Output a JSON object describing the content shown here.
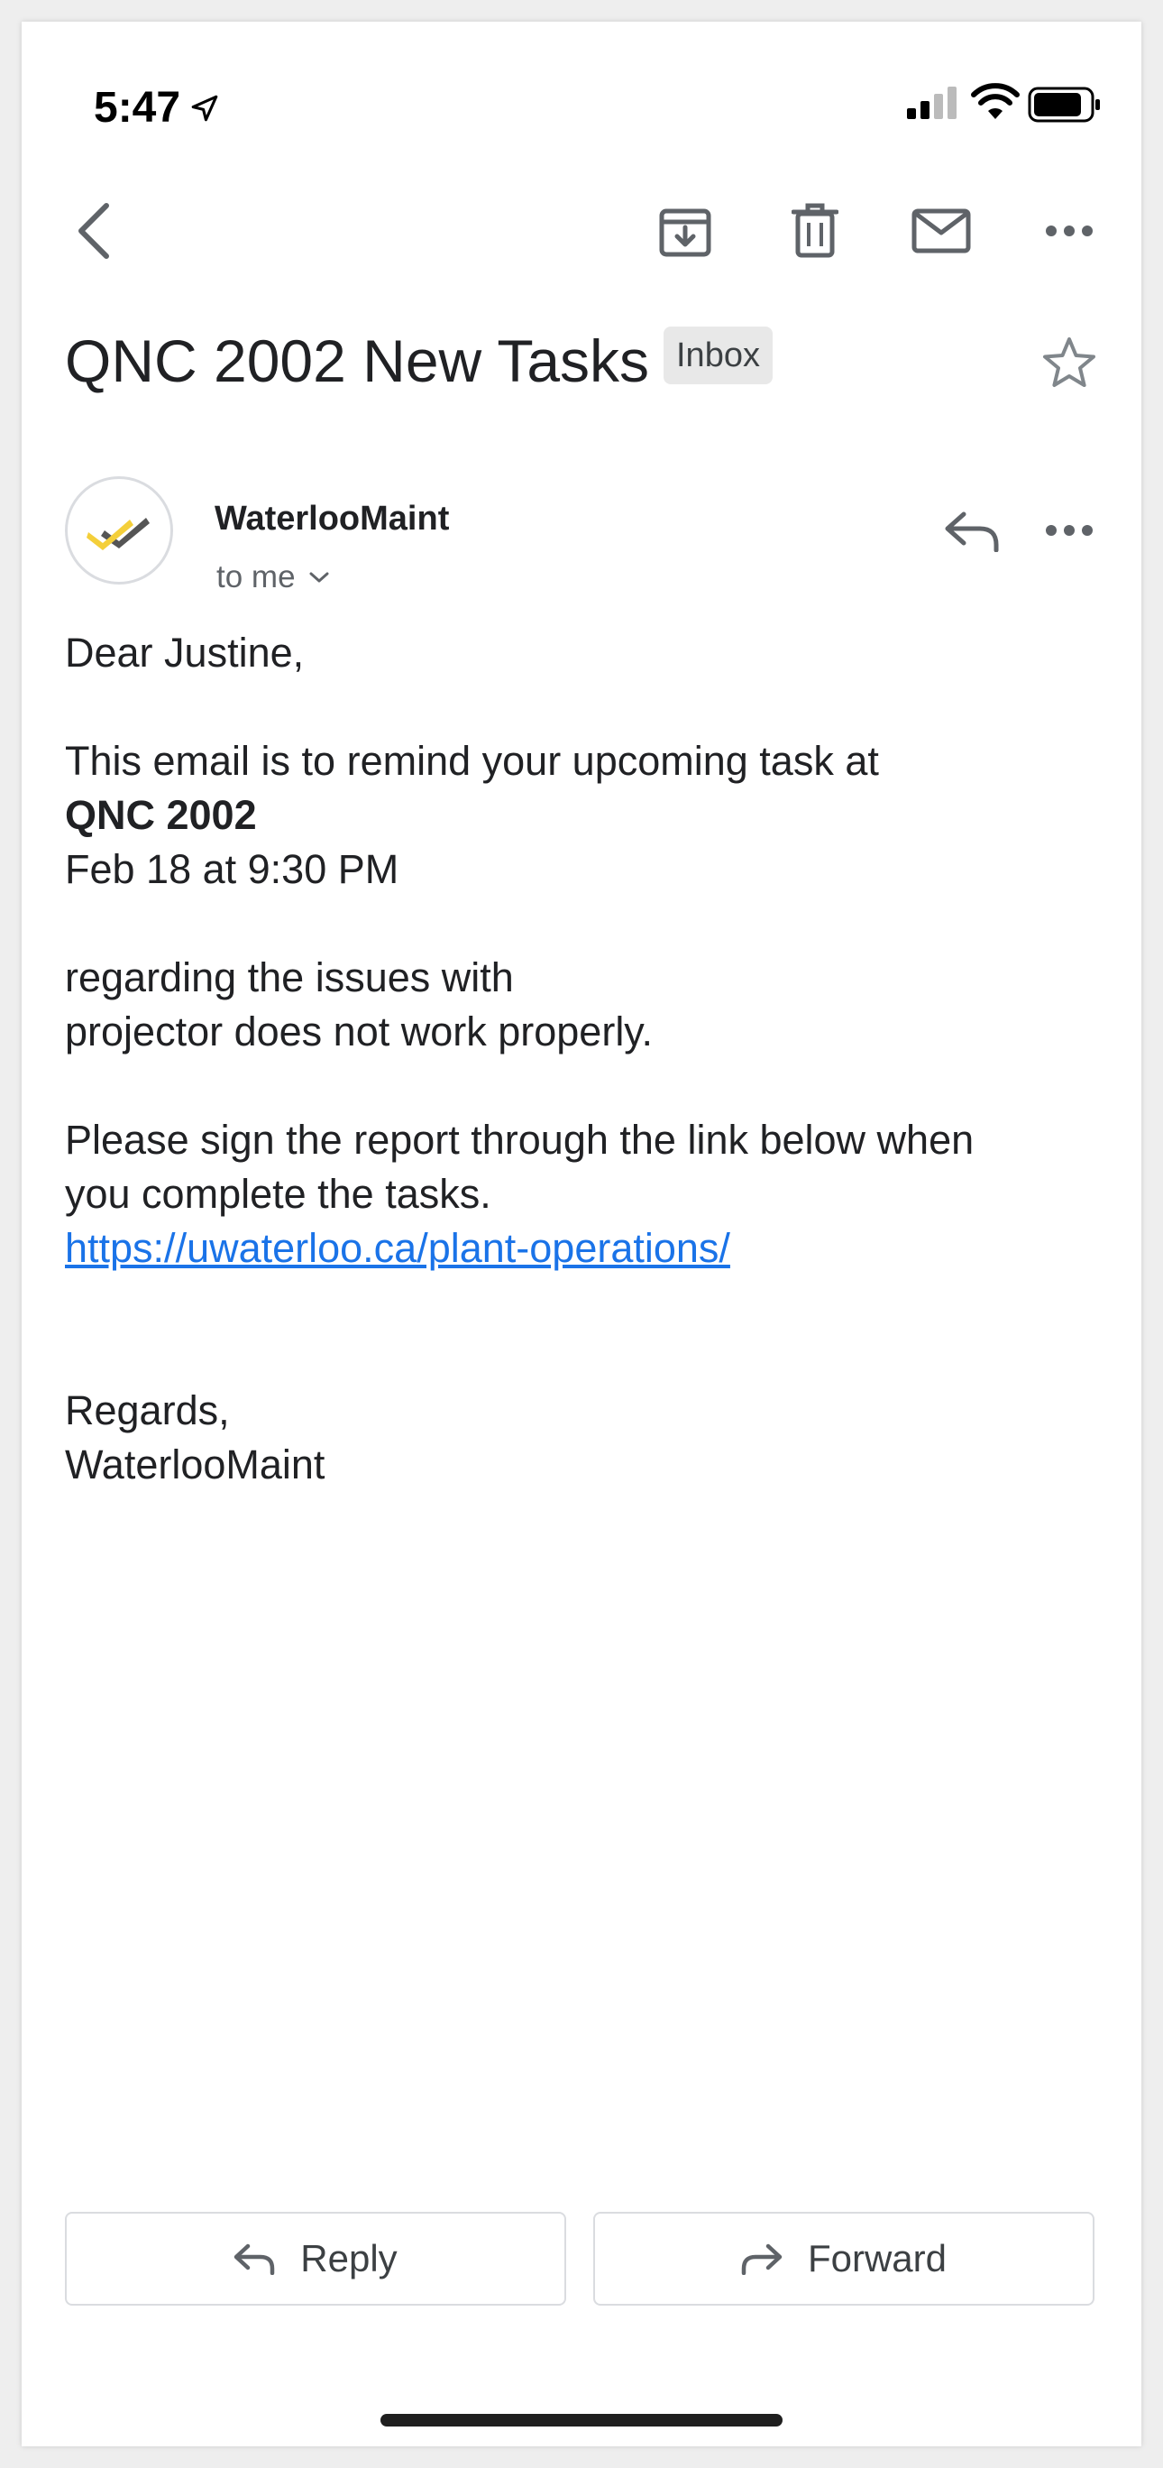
{
  "status_bar": {
    "time": "5:47"
  },
  "email": {
    "subject": "QNC 2002 New Tasks",
    "label": "Inbox",
    "sender": "WaterlooMaint",
    "recipient": "to me",
    "body": {
      "greeting": "Dear Justine,",
      "reminder_line": "This email is to remind your upcoming task at",
      "location": "QNC 2002",
      "datetime": "Feb 18 at 9:30 PM",
      "issue_intro": "regarding the issues with",
      "issue_detail": "projector does not work properly.",
      "instruction_line1": "Please sign the report through the link below when",
      "instruction_line2": "you complete the tasks.",
      "link": "https://uwaterloo.ca/plant-operations/",
      "closing": "Regards,",
      "signature": "WaterlooMaint"
    }
  },
  "actions": {
    "reply_label": "Reply",
    "forward_label": "Forward"
  },
  "colors": {
    "link": "#1a73e8",
    "icon": "#5f6368",
    "text": "#202124",
    "avatar_yellow": "#f4cf3a",
    "avatar_dark": "#555555"
  }
}
